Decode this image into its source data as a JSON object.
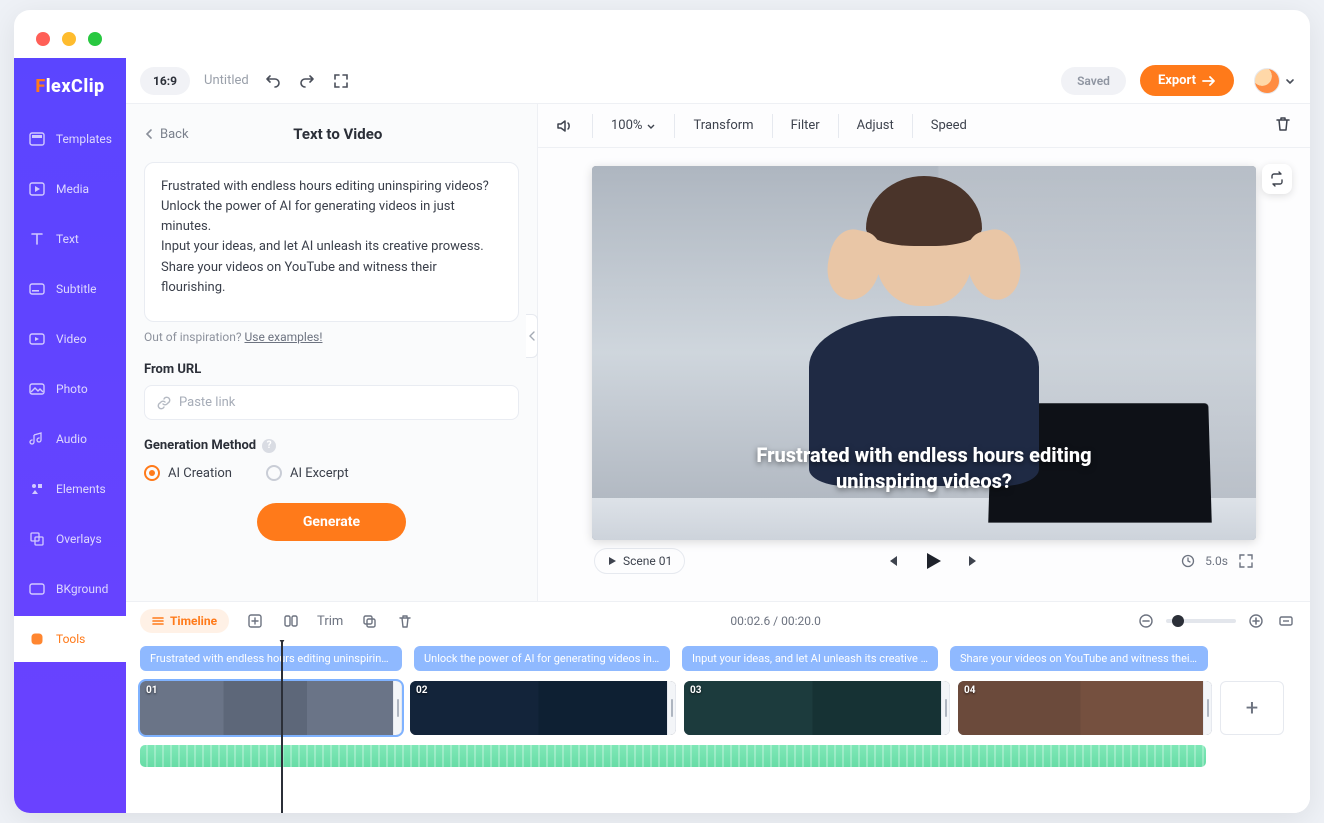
{
  "brand": {
    "name_f": "F",
    "name_rest": "lexClip"
  },
  "sidebar": {
    "items": [
      {
        "label": "Templates"
      },
      {
        "label": "Media"
      },
      {
        "label": "Text"
      },
      {
        "label": "Subtitle"
      },
      {
        "label": "Video"
      },
      {
        "label": "Photo"
      },
      {
        "label": "Audio"
      },
      {
        "label": "Elements"
      },
      {
        "label": "Overlays"
      },
      {
        "label": "BKground"
      },
      {
        "label": "Tools"
      }
    ]
  },
  "topbar": {
    "aspect": "16:9",
    "doc_title": "Untitled",
    "saved": "Saved",
    "export": "Export"
  },
  "panel": {
    "back": "Back",
    "title": "Text to Video",
    "prompt_para": [
      "Frustrated with endless hours editing uninspiring videos?",
      "Unlock the power of AI for generating videos in just minutes.",
      "Input your ideas, and let AI unleash its creative prowess.",
      "Share your videos on YouTube and witness their flourishing."
    ],
    "inspiration_prefix": "Out of inspiration? ",
    "inspiration_link": "Use examples!",
    "from_url_label": "From URL",
    "url_placeholder": "Paste link",
    "gen_method_label": "Generation Method",
    "radio_creation": "AI Creation",
    "radio_excerpt": "AI Excerpt",
    "generate": "Generate"
  },
  "preview": {
    "zoom": "100%",
    "transform": "Transform",
    "filter": "Filter",
    "adjust": "Adjust",
    "speed": "Speed",
    "caption_line1": "Frustrated with endless hours editing",
    "caption_line2": "uninspiring videos?",
    "scene_chip": "Scene 01",
    "duration": "5.0s"
  },
  "timeline": {
    "tab": "Timeline",
    "trim": "Trim",
    "timecode": "00:02.6 / 00:20.0",
    "captions": [
      "Frustrated with endless hours editing uninspirin…",
      "Unlock the power of AI for generating videos in j…",
      "Input your ideas, and let AI unleash its creative …",
      "Share your videos on YouTube and witness their…"
    ],
    "clips": [
      {
        "num": "01"
      },
      {
        "num": "02"
      },
      {
        "num": "03"
      },
      {
        "num": "04"
      }
    ]
  }
}
